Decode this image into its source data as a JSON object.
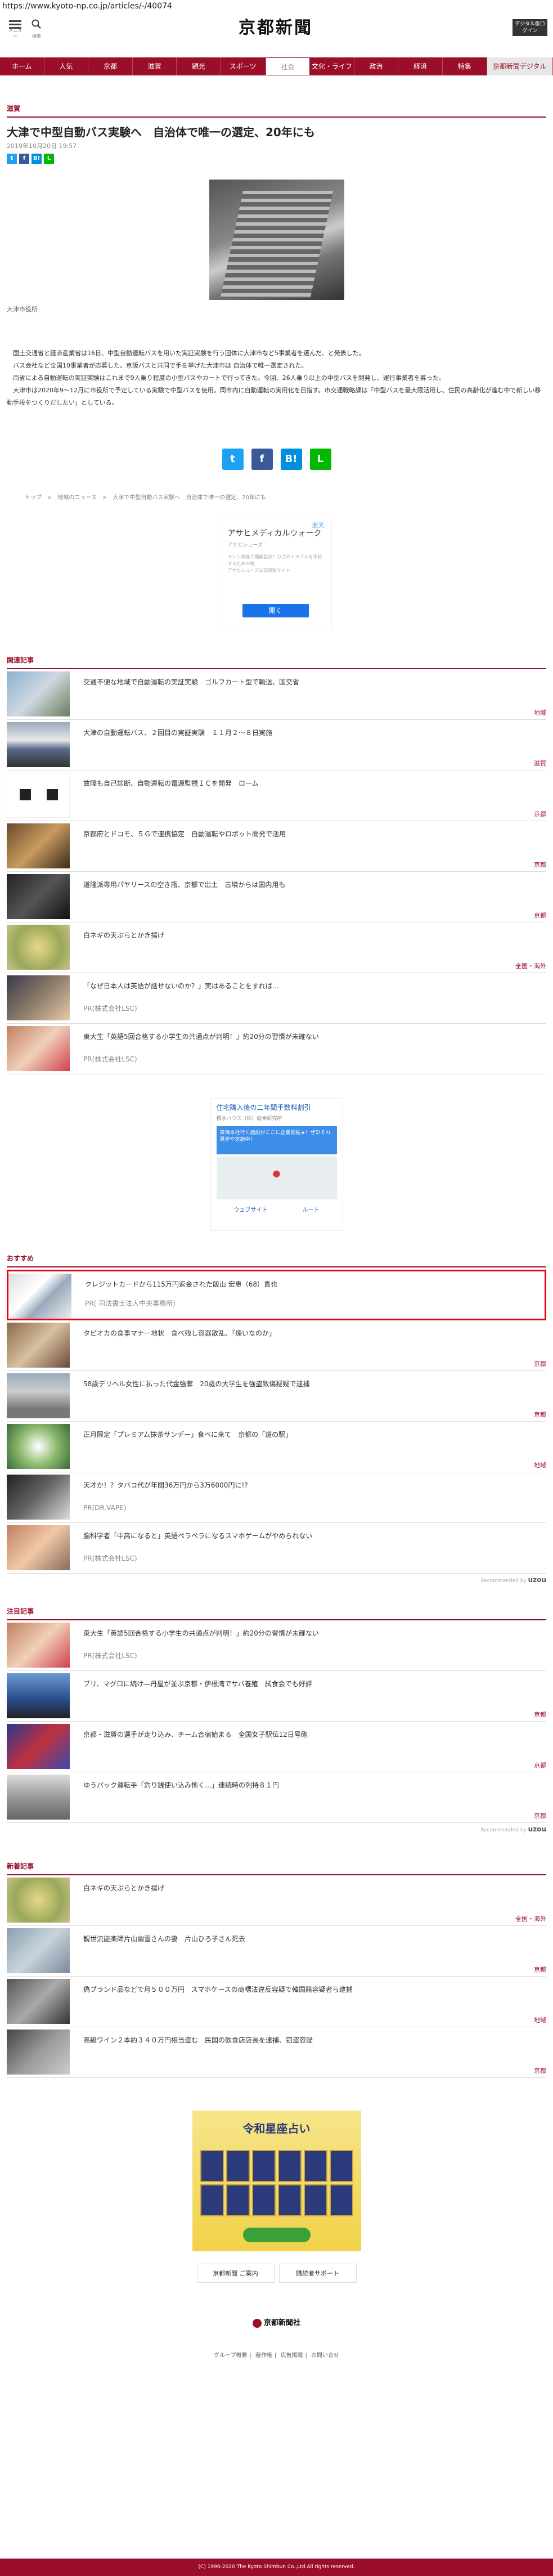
{
  "url": "https://www.kyoto-np.co.jp/articles/-/40074",
  "header": {
    "menu_caption": "メニュー",
    "search_caption": "検索",
    "logo": "京都新聞",
    "digital_btn": "デジタル版ログイン"
  },
  "nav": [
    "ホーム",
    "人気",
    "京都",
    "滋賀",
    "観光",
    "スポーツ",
    "社会",
    "文化・ライフ",
    "政治",
    "経済",
    "特集",
    "京都新聞デジタル"
  ],
  "article": {
    "category": "滋賀",
    "title": "大津で中型自動バス実験へ　自治体で唯一の選定、20年にも",
    "date": "2019年10月20日 19:57",
    "share_small": [
      "t",
      "f",
      "B!",
      "L"
    ],
    "photo_caption": "大津市役所",
    "paragraphs": [
      "国土交通省と経済産業省は16日、中型自動運転バスを用いた実証実験を行う団体に大津市など5事業者を選んだ、と発表した。",
      "バス会社など全国10事業者が応募した。京阪バスと共同で手を挙げた大津市は 自治体で唯一選定された。",
      "両省による自動運転の実証実験はこれまで9人乗り程度の小型バスやカートで行ってきた。今回、26人乗り以上の中型バスを開発し、運行事業者を募った。",
      "大津市は2020年9〜12月に市役所で予定している実験で中型バスを使用。同市内に自動運転の実用化を目指す。市交通戦略課は「中型バスを最大限活用し、住民の高齢化が進む中で新しい移動手段をつくりだしたい」としている。"
    ],
    "share_big": [
      "t",
      "f",
      "B!",
      "L"
    ],
    "breadcrumb": "トップ　>　地域のニュース　>　大津で中型自動バス実験へ　自治体で唯一の選定、20年にも"
  },
  "ad1": {
    "tag": "楽天",
    "title": "アサヒメディカルウォーク",
    "sub": "アサヒシューズ",
    "desc": "ラシン規格で開発設計！ひざのトラブルを予防するための靴",
    "desc2": "アサヒシューズ公式通販サイト",
    "button": "開く"
  },
  "related": {
    "heading": "関連記事",
    "items": [
      {
        "text": "交通不便な地域で自動運転の実証実験　ゴルフカート型で輸送、国交省",
        "area": "地域",
        "pr": ""
      },
      {
        "text": "大津の自動運転バス、２回目の実証実験　１１月２〜８日実施",
        "area": "滋賀",
        "pr": ""
      },
      {
        "text": "故障も自己診断、自動運転の電源監視ＩＣを開発　ローム",
        "area": "京都",
        "pr": ""
      },
      {
        "text": "京都府とドコモ、５Ｇで連携協定　自動運転やロボット開発で活用",
        "area": "京都",
        "pr": ""
      },
      {
        "text": "道隆派専用パヤリースの空き瓶、京都で出土　古墳からは国内用も",
        "area": "京都",
        "pr": ""
      },
      {
        "text": "白ネギの天ぷらとかき揚げ",
        "area": "全国・海外",
        "pr": ""
      },
      {
        "text": "「なぜ日本人は英語が話せないのか？」実はあることをすれば…",
        "area": "",
        "pr": "PR(株式会社LSC)"
      },
      {
        "text": "東大生「英語5回合格する小学生の共通点が判明！」約20分の習慣が未確ない",
        "area": "",
        "pr": "PR(株式会社LSC)"
      }
    ]
  },
  "ad2": {
    "title": "住宅購入後の二年間手数料割引",
    "sub": "積水ハウス（株）総合研究所",
    "blue": "東海本社行く施設がここに企業開催★！ぜひそれ見学や実施中！",
    "btn1": "ウェブサイト",
    "btn2": "ルート"
  },
  "recommend": {
    "heading": "おすすめ",
    "items": [
      {
        "text": "クレジットカードから115万円返金された飯山 宏恵（68）貴也",
        "area": "",
        "pr": "PR( 司法書士法人中央事務所)"
      },
      {
        "text": "タピオカの食事マナー地状　食べ残し容器散乱、「煉いなのか」",
        "area": "京都",
        "pr": ""
      },
      {
        "text": "58歳デリヘル女性に払った代金強奪　20歳の大学生を強盗致傷疑疑で逮捕",
        "area": "京都",
        "pr": ""
      },
      {
        "text": "正月限定「プレミアム抹茶サンデー」食べに来て　京都の「道の駅」",
        "area": "地域",
        "pr": ""
      },
      {
        "text": "天才か！？タバコ代が年間36万円から3万6000円に!?",
        "area": "",
        "pr": "PR(DR.VAPE)"
      },
      {
        "text": "脳科学者「中高になると」英語ペラペラになるスマホゲームがやめられない",
        "area": "",
        "pr": "PR(株式会社LSC)"
      }
    ],
    "credit_prefix": "Recommended by",
    "credit_brand": "uzou"
  },
  "attention": {
    "heading": "注目記事",
    "items": [
      {
        "text": "東大生「英語5回合格する小学生の共通点が判明！」約20分の習慣が未確ない",
        "area": "",
        "pr": "PR(株式会社LSC)"
      },
      {
        "text": "ブリ、マグロに続け―丹屋が並ぶ京都・伊根湾でサバ養殖　試食会でも好評",
        "area": "京都",
        "pr": ""
      },
      {
        "text": "京都・滋賀の選手が走り込み、チーム合宿始まる　全国女子駅伝12日号砲",
        "area": "京都",
        "pr": ""
      },
      {
        "text": "ゆうパック運転手「釣り銭使い込み怖く…」連続時の列持８１円",
        "area": "京都",
        "pr": ""
      }
    ],
    "credit_prefix": "Recommended by",
    "credit_brand": "uzou"
  },
  "latest": {
    "heading": "新着記事",
    "items": [
      {
        "text": "白ネギの天ぷらとかき揚げ",
        "area": "全国・海外",
        "pr": ""
      },
      {
        "text": "観世流能楽師片山幽雪さんの妻　片山ひろ子さん死去",
        "area": "京都",
        "pr": ""
      },
      {
        "text": "偽ブランド品などで月５００万円　スマホケースの商標法違反容疑で韓国籍容疑者ら逮捕",
        "area": "地域",
        "pr": ""
      },
      {
        "text": "高級ワイン２本約３４０万円相当盗む　民国の飲食店店長を逮捕、窃盗容疑",
        "area": "京都",
        "pr": ""
      }
    ]
  },
  "ad3": {
    "title": "令和星座占い"
  },
  "footer": {
    "links_buttons": [
      "京都新聞 ご案内",
      "購読者サポート"
    ],
    "logo": "京都新聞社",
    "links": [
      "グループ概要",
      "著作権",
      "広告掲載",
      "お問い合せ"
    ],
    "copyright": "(C) 1996-2020 The Kyoto Shimbun Co.,Ltd All rights reserved."
  },
  "colors": {
    "brand": "#9b0e2a",
    "highlight": "#e50012"
  }
}
